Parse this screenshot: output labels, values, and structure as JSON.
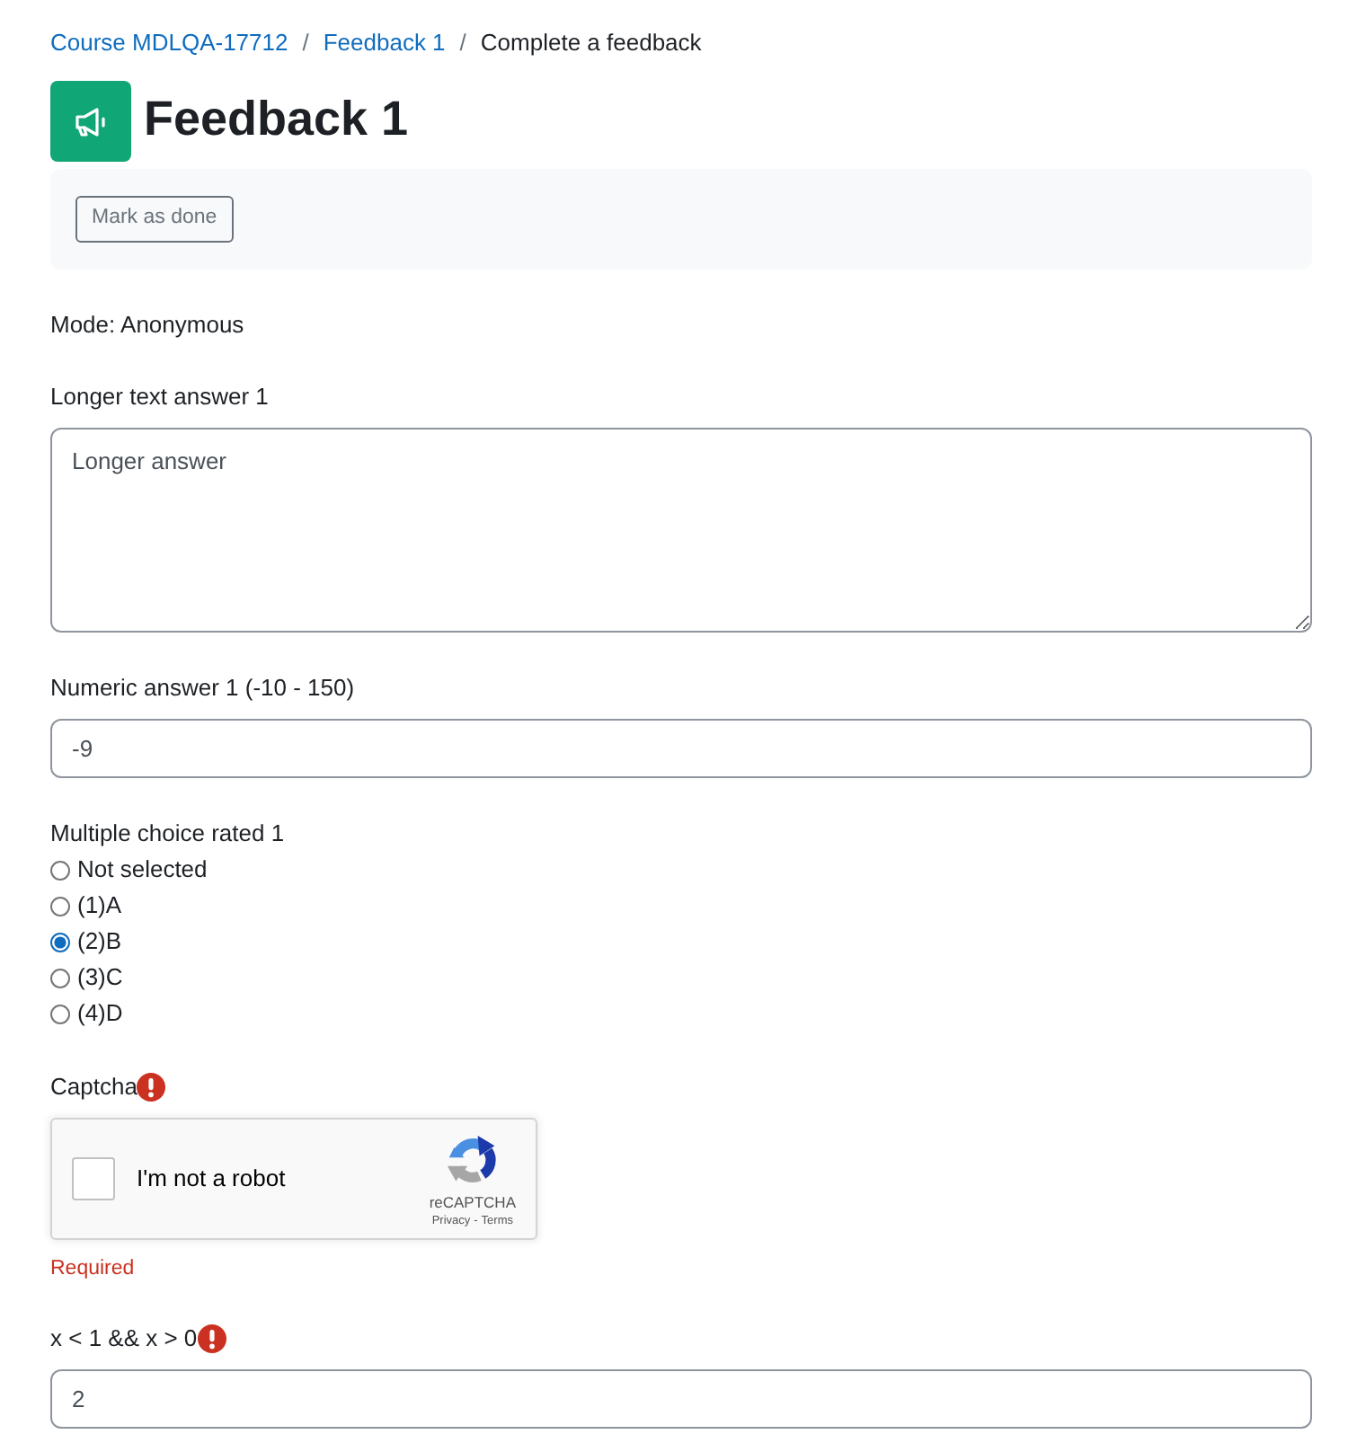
{
  "breadcrumb": {
    "items": [
      {
        "label": "Course MDLQA-17712",
        "kind": "link"
      },
      {
        "label": "Feedback 1",
        "kind": "link"
      },
      {
        "label": "Complete a feedback",
        "kind": "current"
      }
    ],
    "separators": [
      "/",
      "/"
    ]
  },
  "activity": {
    "title": "Feedback 1",
    "mark_done_button": "Mark as done"
  },
  "mode": "Mode: Anonymous",
  "questions": [
    {
      "kind": "textarea",
      "label": "Longer text answer 1",
      "error": false,
      "value": "Longer answer"
    },
    {
      "kind": "text",
      "label": "Numeric answer 1 (-10 - 150)",
      "error": false,
      "value": "-9"
    },
    {
      "kind": "radio",
      "label": "Multiple choice rated 1",
      "error": false,
      "options": [
        {
          "label": "Not selected",
          "selected": false
        },
        {
          "label": "(1)A",
          "selected": false
        },
        {
          "label": "(2)B",
          "selected": true
        },
        {
          "label": "(3)C",
          "selected": false
        },
        {
          "label": "(4)D",
          "selected": false
        }
      ]
    },
    {
      "kind": "captcha",
      "label": "Captcha",
      "error": true,
      "checkbox": {
        "label": "I'm not a robot",
        "checked": false
      },
      "brand": "reCAPTCHA",
      "links": [
        "Privacy",
        "Terms"
      ],
      "link_separator": "-",
      "message": "Required"
    },
    {
      "kind": "text",
      "label": "x < 1 && x > 0",
      "error": true,
      "value": "2"
    }
  ]
}
